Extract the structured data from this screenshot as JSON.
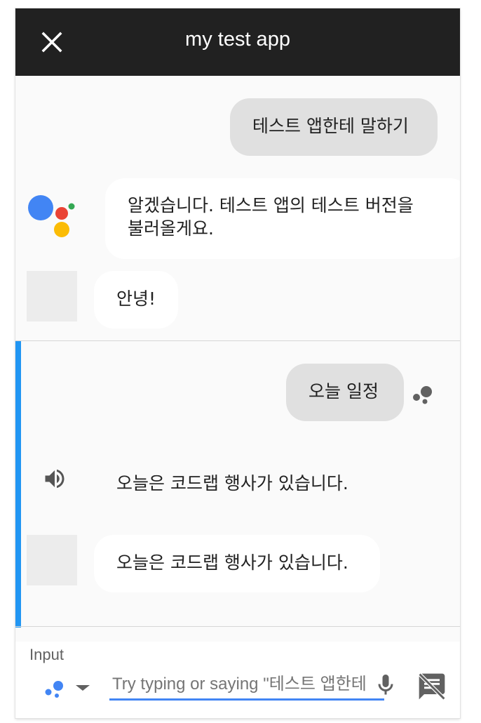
{
  "header": {
    "title": "my test app",
    "close_icon": "close-icon"
  },
  "conversation": {
    "section1": {
      "user_message": "테스트 앱한테 말하기",
      "assistant_reply_line1": "알겠습니다. 테스트 앱의 테스트 버전을",
      "assistant_reply_line2": "불러올게요.",
      "app_reply": "안녕!"
    },
    "section2": {
      "user_message": "오늘 일정",
      "spoken_text": "오늘은 코드랩 행사가 있습니다.",
      "app_reply": "오늘은 코드랩 행사가 있습니다."
    }
  },
  "input_panel": {
    "label": "Input",
    "placeholder": "Try typing or saying \"테스트 앱한테",
    "icons": [
      "assistant-dots-icon",
      "chevron-down-icon",
      "microphone-icon",
      "speech-bubble-off-icon"
    ]
  },
  "colors": {
    "topbar": "#212121",
    "accent": "#2196f3",
    "google_blue": "#4285f4",
    "google_red": "#ea4335",
    "google_yellow": "#fbbc05",
    "google_green": "#34a853"
  }
}
